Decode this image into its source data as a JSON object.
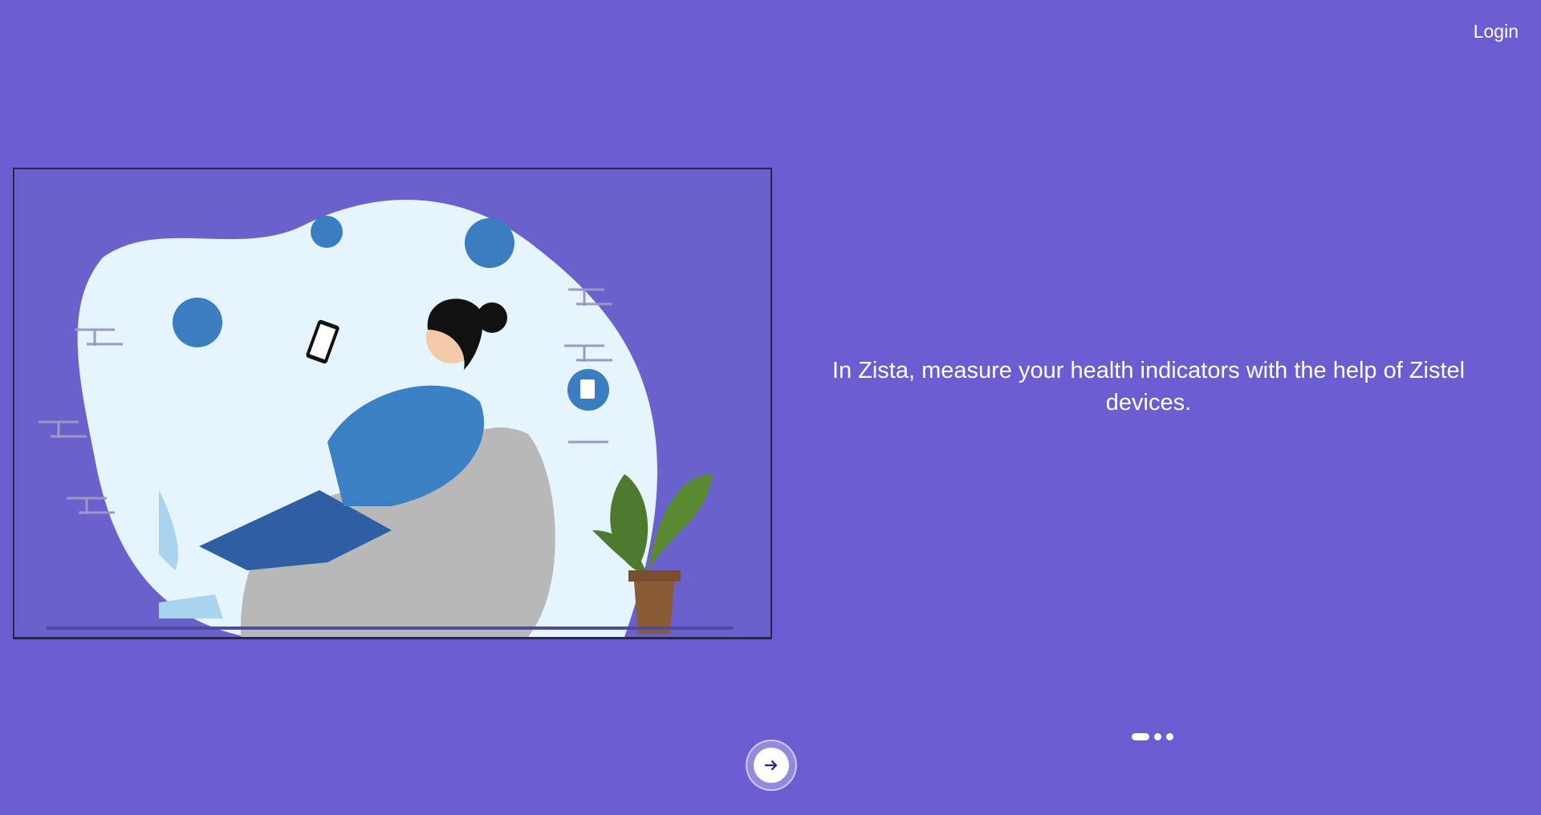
{
  "header": {
    "login_label": "Login"
  },
  "onboarding": {
    "caption": "In Zista, measure your health indicators with the help of Zistel devices.",
    "current_slide": 1,
    "total_slides": 3,
    "next_icon": "arrow-right-icon"
  },
  "colors": {
    "background": "#6a5dd1",
    "accent_dark": "#2b1d8f"
  }
}
